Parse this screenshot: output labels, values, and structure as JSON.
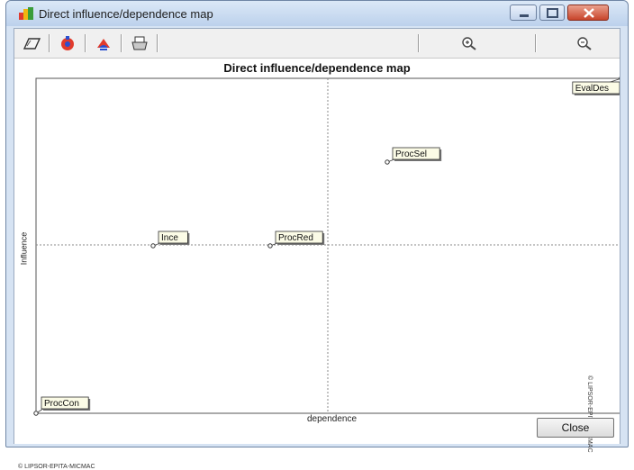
{
  "window": {
    "title": "Direct influence/dependence map",
    "buttons": [
      "minimize",
      "maximize",
      "close"
    ]
  },
  "toolbar": {
    "left_icons": [
      "open-icon",
      "color-icon",
      "copy-icon",
      "print-icon"
    ],
    "right_icons": [
      "zoom-in-icon",
      "zoom-out-icon"
    ]
  },
  "chart": {
    "title": "Direct influence/dependence map",
    "ylabel": "Influence",
    "xlabel": "dependence",
    "side_copyright": "© LIPSOR-EPITA-MICMAC"
  },
  "chart_data": {
    "type": "scatter",
    "title": "Direct influence/dependence map",
    "xlabel": "dependence",
    "ylabel": "Influence",
    "xlim": [
      0,
      100
    ],
    "ylim": [
      0,
      100
    ],
    "grid": false,
    "crosshair": [
      50,
      50
    ],
    "points": [
      {
        "label": "EvalDes",
        "x": 100,
        "y": 100
      },
      {
        "label": "ProcSel",
        "x": 60,
        "y": 75
      },
      {
        "label": "Ince",
        "x": 20,
        "y": 50
      },
      {
        "label": "ProcRed",
        "x": 40,
        "y": 50
      },
      {
        "label": "ProcCon",
        "x": 0,
        "y": 0
      }
    ]
  },
  "footer": {
    "copyright": "© LIPSOR-EPITA-MICMAC",
    "close_label": "Close"
  },
  "colors": {
    "title_bar": "#bcd1ec",
    "close_button": "#c8442b",
    "label_bg": "#fbfbe6"
  }
}
